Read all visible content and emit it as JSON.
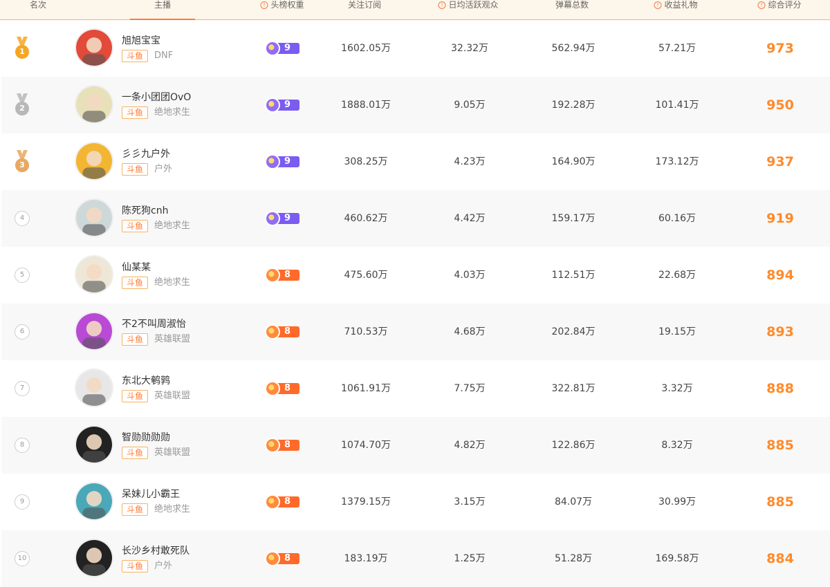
{
  "columns": {
    "rank": "名次",
    "streamer": "主播",
    "weight": "头榜权重",
    "followers": "关注订阅",
    "daily_viewers": "日均活跃观众",
    "danmaku": "弹幕总数",
    "gifts": "收益礼物",
    "score": "综合评分"
  },
  "colors": {
    "accent": "#ff8a2a",
    "purple": "#7b5cf0",
    "orange": "#ff6a2a",
    "gold": "#f5a623",
    "silver": "#b8b8b8",
    "bronze": "#e8a860"
  },
  "rows": [
    {
      "rank": "1",
      "name": "旭旭宝宝",
      "platform": "斗鱼",
      "category": "DNF",
      "weight": "9",
      "followers": "1602.05万",
      "daily": "32.32万",
      "danmaku": "562.94万",
      "gifts": "57.21万",
      "score": "973"
    },
    {
      "rank": "2",
      "name": "一条小团团OvO",
      "platform": "斗鱼",
      "category": "绝地求生",
      "weight": "9",
      "followers": "1888.01万",
      "daily": "9.05万",
      "danmaku": "192.28万",
      "gifts": "101.41万",
      "score": "950"
    },
    {
      "rank": "3",
      "name": "彡彡九户外",
      "platform": "斗鱼",
      "category": "户外",
      "weight": "9",
      "followers": "308.25万",
      "daily": "4.23万",
      "danmaku": "164.90万",
      "gifts": "173.12万",
      "score": "937"
    },
    {
      "rank": "4",
      "name": "陈死狗cnh",
      "platform": "斗鱼",
      "category": "绝地求生",
      "weight": "9",
      "followers": "460.62万",
      "daily": "4.42万",
      "danmaku": "159.17万",
      "gifts": "60.16万",
      "score": "919"
    },
    {
      "rank": "5",
      "name": "仙某某",
      "platform": "斗鱼",
      "category": "绝地求生",
      "weight": "8",
      "followers": "475.60万",
      "daily": "4.03万",
      "danmaku": "112.51万",
      "gifts": "22.68万",
      "score": "894"
    },
    {
      "rank": "6",
      "name": "不2不叫周淑怡",
      "platform": "斗鱼",
      "category": "英雄联盟",
      "weight": "8",
      "followers": "710.53万",
      "daily": "4.68万",
      "danmaku": "202.84万",
      "gifts": "19.15万",
      "score": "893"
    },
    {
      "rank": "7",
      "name": "东北大鹌鹑",
      "platform": "斗鱼",
      "category": "英雄联盟",
      "weight": "8",
      "followers": "1061.91万",
      "daily": "7.75万",
      "danmaku": "322.81万",
      "gifts": "3.32万",
      "score": "888"
    },
    {
      "rank": "8",
      "name": "智勋勋勋勋",
      "platform": "斗鱼",
      "category": "英雄联盟",
      "weight": "8",
      "followers": "1074.70万",
      "daily": "4.82万",
      "danmaku": "122.86万",
      "gifts": "8.32万",
      "score": "885"
    },
    {
      "rank": "9",
      "name": "呆妹儿小霸王",
      "platform": "斗鱼",
      "category": "绝地求生",
      "weight": "8",
      "followers": "1379.15万",
      "daily": "3.15万",
      "danmaku": "84.07万",
      "gifts": "30.99万",
      "score": "885"
    },
    {
      "rank": "10",
      "name": "长沙乡村敢死队",
      "platform": "斗鱼",
      "category": "户外",
      "weight": "8",
      "followers": "183.19万",
      "daily": "1.25万",
      "danmaku": "51.28万",
      "gifts": "169.58万",
      "score": "884"
    }
  ]
}
